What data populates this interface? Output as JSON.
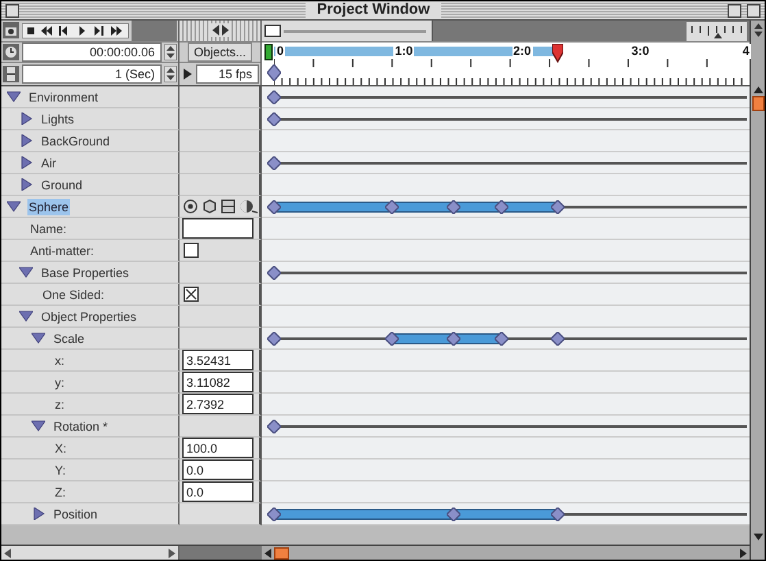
{
  "window": {
    "title": "Project Window"
  },
  "transport": {
    "time": "00:00:00.06",
    "unit": "1 (Sec)",
    "objects_button": "Objects...",
    "fps": "15 fps"
  },
  "zoom_slider": {
    "level": 0
  },
  "ruler": {
    "playhead": {
      "level": 0.6
    },
    "labels": [
      "0",
      "1:0",
      "2:0",
      "3:0",
      "4"
    ]
  },
  "tree": [
    {
      "label": "Environment",
      "kind": "group",
      "expanded": true,
      "selected": false,
      "keys": [
        {
          "level": 0
        }
      ],
      "children": [
        {
          "label": "Lights",
          "kind": "group",
          "expanded": false,
          "selected": false,
          "keys": [
            {
              "level": 0
            }
          ]
        },
        {
          "label": "BackGround",
          "kind": "group",
          "expanded": false,
          "selected": false
        },
        {
          "label": "Air",
          "kind": "group",
          "expanded": false,
          "selected": false,
          "keys": [
            {
              "level": 0
            }
          ]
        },
        {
          "label": "Ground",
          "kind": "group",
          "expanded": false,
          "selected": false
        }
      ]
    },
    {
      "label": "Sphere",
      "kind": "object",
      "expanded": true,
      "selected": true,
      "keys": [
        {
          "level": 0,
          "tweened": true
        },
        {
          "level": 0.25,
          "tweened": true
        },
        {
          "level": 0.38,
          "tweened": true
        },
        {
          "level": 0.48,
          "tweened": true
        },
        {
          "level": 0.6
        }
      ],
      "children": [
        {
          "label": "Name:",
          "kind": "field",
          "selected": false
        },
        {
          "label": "Anti-matter:",
          "kind": "checkbox",
          "checked": false,
          "selected": false
        },
        {
          "label": "Base Properties",
          "kind": "group",
          "expanded": true,
          "selected": false,
          "keys": [
            {
              "level": 0
            }
          ],
          "children": [
            {
              "label": "One Sided:",
              "kind": "checkbox",
              "checked": true,
              "selected": false
            }
          ]
        },
        {
          "label": "Object Properties",
          "kind": "group",
          "expanded": true,
          "selected": false,
          "children": [
            {
              "label": "Scale",
              "kind": "group",
              "expanded": true,
              "selected": false,
              "keys": [
                {
                  "level": 0,
                  "tweened": false
                },
                {
                  "level": 0.25,
                  "tweened": true
                },
                {
                  "level": 0.38,
                  "tweened": true
                },
                {
                  "level": 0.48,
                  "tweened": false
                },
                {
                  "level": 0.6
                }
              ],
              "children": [
                {
                  "label": "x:",
                  "kind": "field",
                  "value": "3.52431",
                  "selected": false
                },
                {
                  "label": "y:",
                  "kind": "field",
                  "value": "3.11082",
                  "selected": false
                },
                {
                  "label": "z:",
                  "kind": "field",
                  "value": "2.7392",
                  "selected": false
                }
              ]
            },
            {
              "label": "Rotation *",
              "kind": "group",
              "expanded": true,
              "selected": false,
              "keys": [
                {
                  "level": 0
                }
              ],
              "children": [
                {
                  "label": "X:",
                  "kind": "field",
                  "value": "100.0",
                  "selected": false
                },
                {
                  "label": "Y:",
                  "kind": "field",
                  "value": "0.0",
                  "selected": false
                },
                {
                  "label": "Z:",
                  "kind": "field",
                  "value": "0.0",
                  "selected": false
                }
              ]
            },
            {
              "label": "Position",
              "kind": "group",
              "expanded": false,
              "selected": false,
              "keys": [
                {
                  "level": 0,
                  "tweened": true
                },
                {
                  "level": 0.38,
                  "tweened": true
                },
                {
                  "level": 0.6
                }
              ]
            }
          ]
        }
      ]
    }
  ]
}
